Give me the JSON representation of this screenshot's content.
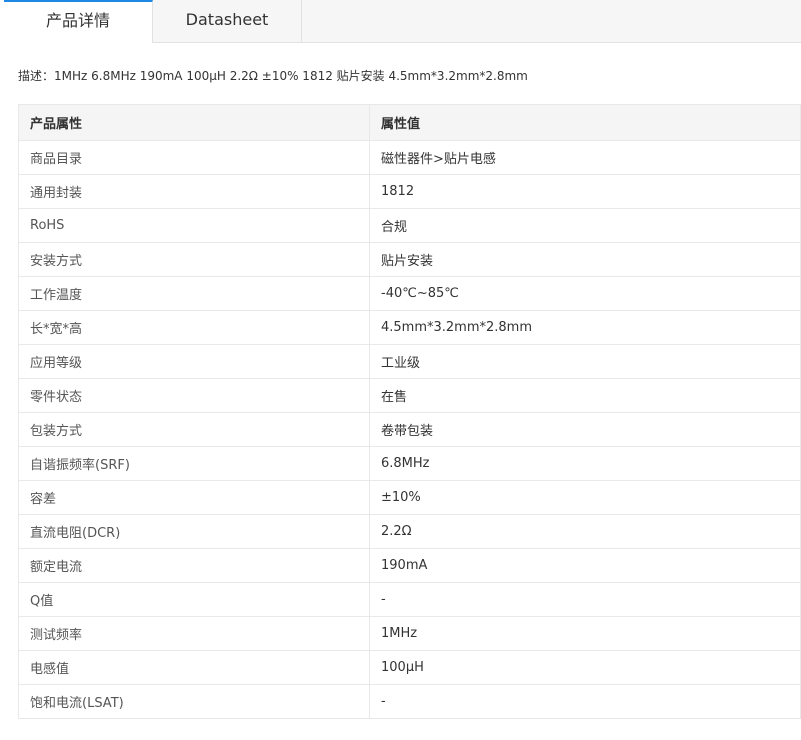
{
  "tabs": [
    {
      "label": "产品详情",
      "active": true
    },
    {
      "label": "Datasheet",
      "active": false
    }
  ],
  "description": "描述：1MHz 6.8MHz 190mA 100μH 2.2Ω ±10% 1812 贴片安装 4.5mm*3.2mm*2.8mm",
  "table": {
    "headers": [
      "产品属性",
      "属性值"
    ],
    "rows": [
      [
        "商品目录",
        "磁性器件>贴片电感"
      ],
      [
        "通用封装",
        "1812"
      ],
      [
        "RoHS",
        "合规"
      ],
      [
        "安装方式",
        "贴片安装"
      ],
      [
        "工作温度",
        "-40℃~85℃"
      ],
      [
        "长*宽*高",
        "4.5mm*3.2mm*2.8mm"
      ],
      [
        "应用等级",
        "工业级"
      ],
      [
        "零件状态",
        "在售"
      ],
      [
        "包装方式",
        "卷带包装"
      ],
      [
        "自谐振频率(SRF)",
        "6.8MHz"
      ],
      [
        "容差",
        "±10%"
      ],
      [
        "直流电阻(DCR)",
        "2.2Ω"
      ],
      [
        "额定电流",
        "190mA"
      ],
      [
        "Q值",
        "-"
      ],
      [
        "测试频率",
        "1MHz"
      ],
      [
        "电感值",
        "100μH"
      ],
      [
        "饱和电流(LSAT)",
        "-"
      ]
    ]
  },
  "colors": {
    "accent": "#1e88e5",
    "border": "#e8e8e8",
    "header_bg": "#f5f5f5"
  }
}
